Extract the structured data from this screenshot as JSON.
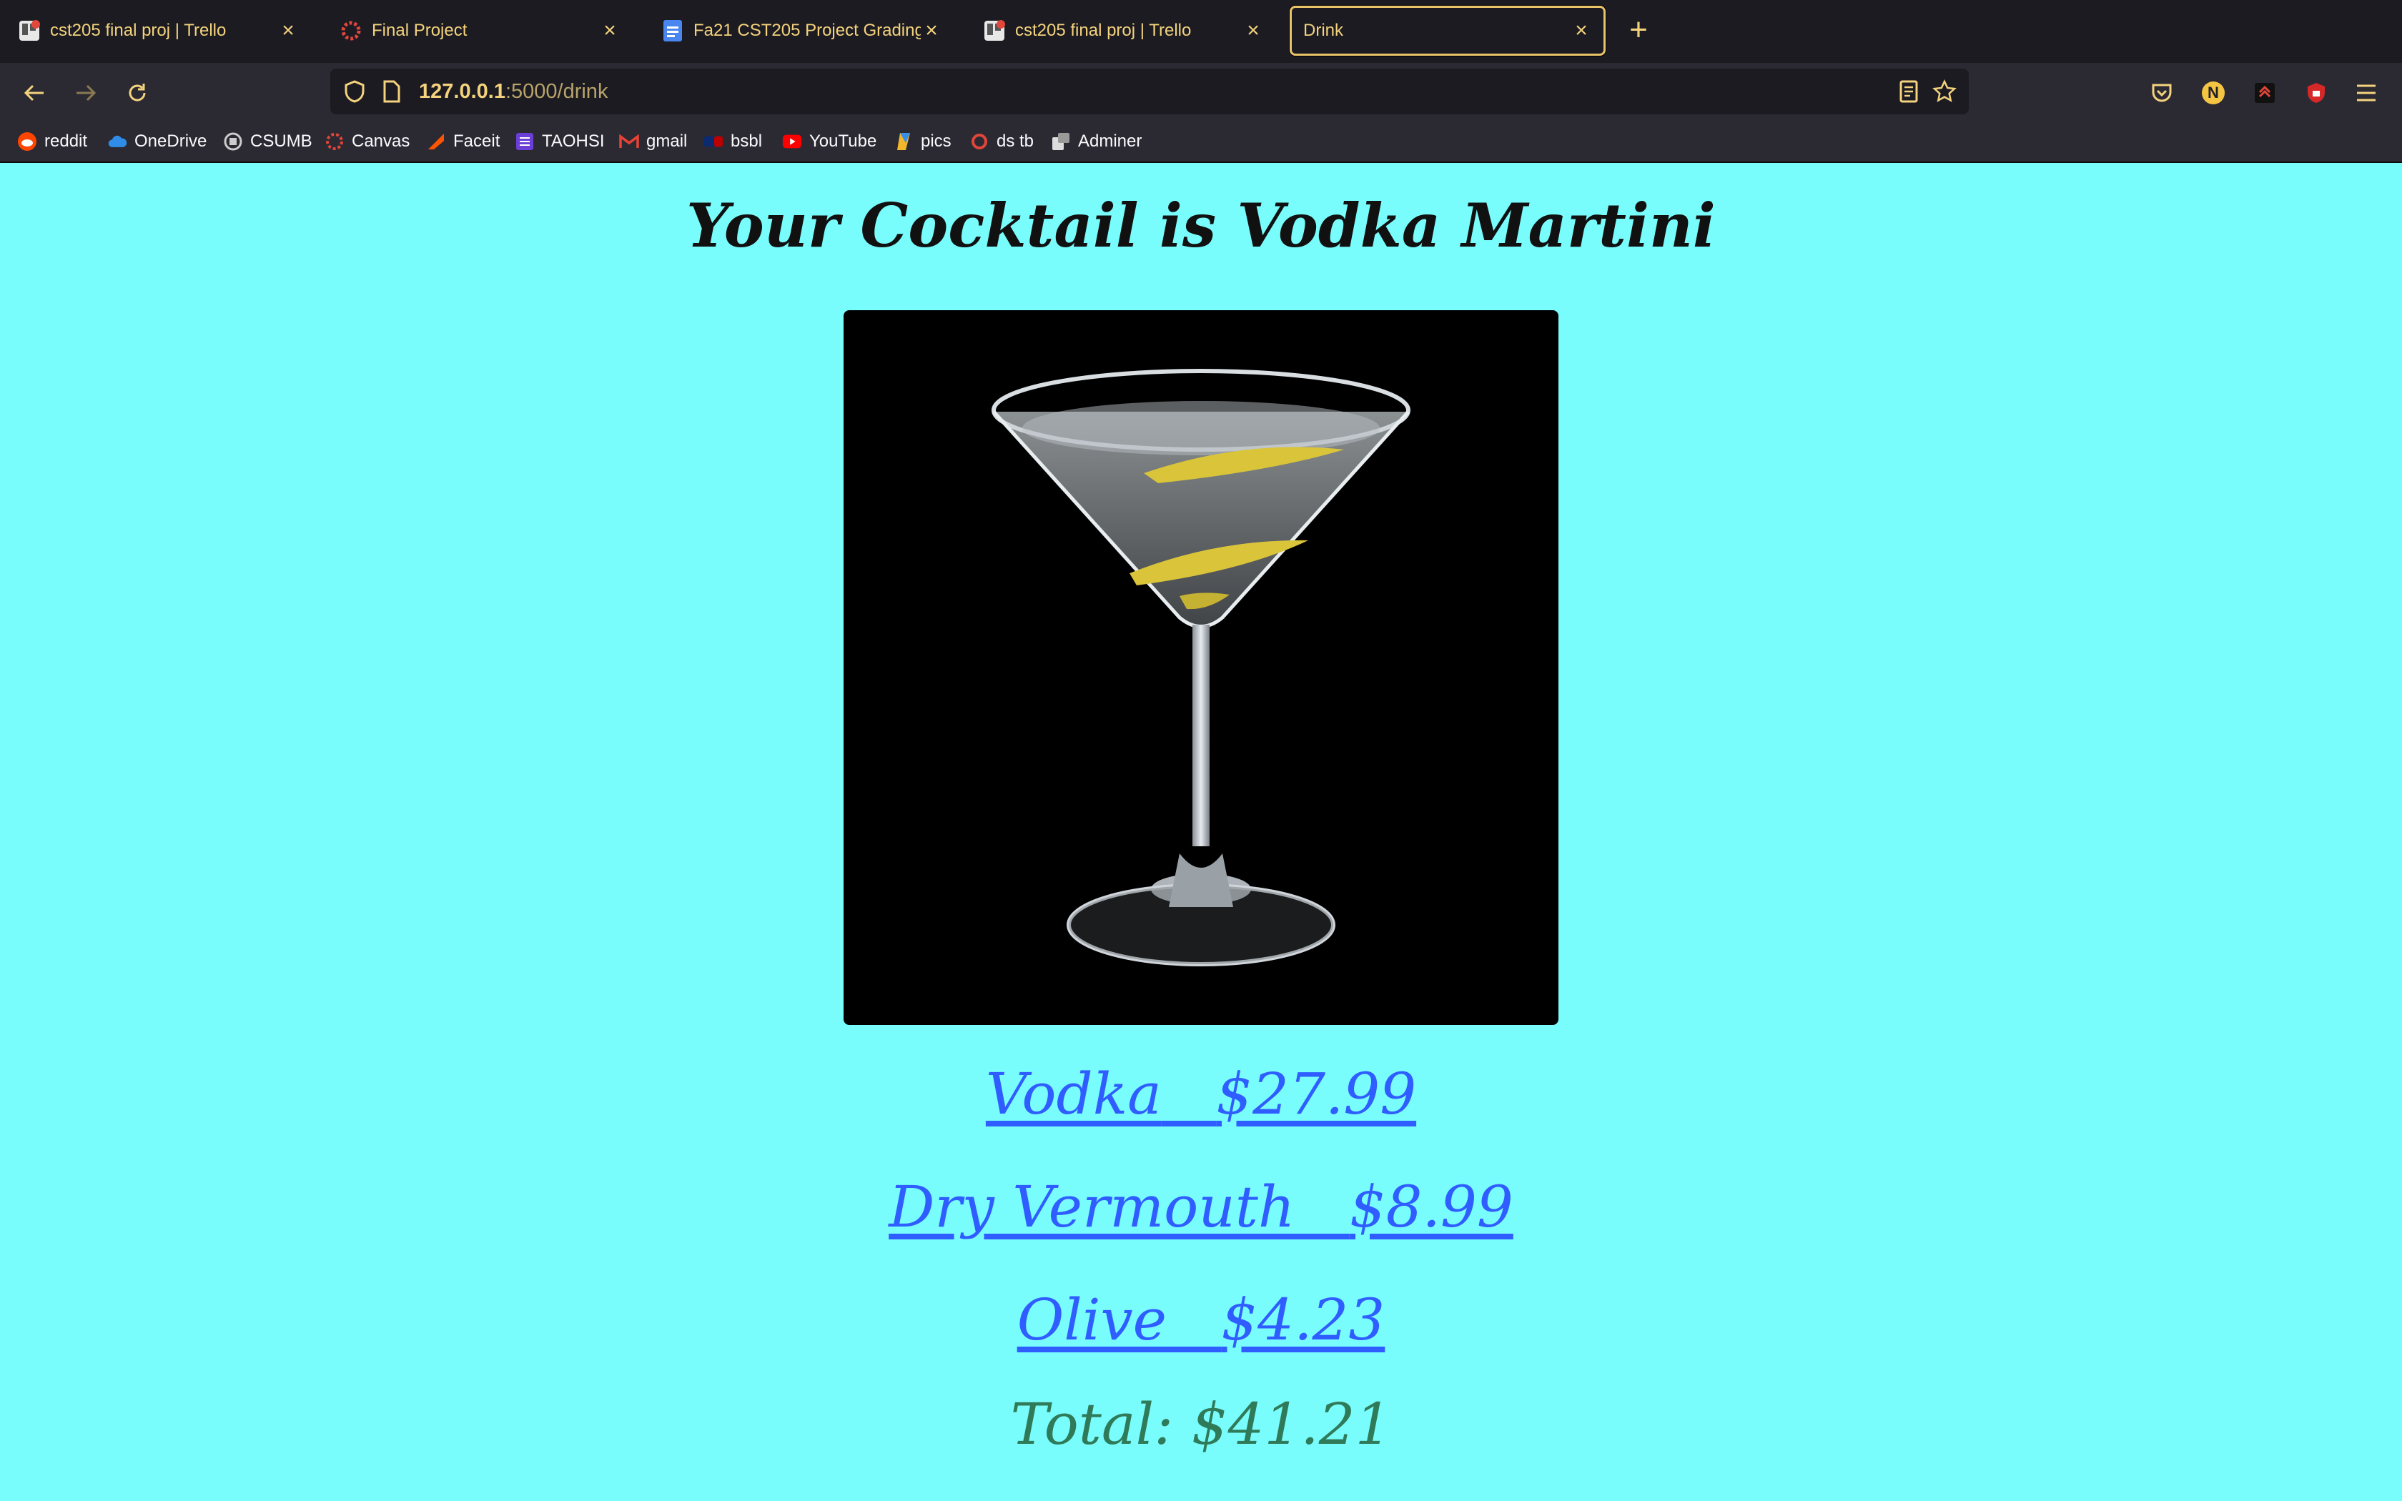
{
  "browser": {
    "tabs": [
      {
        "title": "cst205 final proj | Trello",
        "icon": "trello-icon",
        "active": false
      },
      {
        "title": "Final Project",
        "icon": "canvas-icon",
        "active": false
      },
      {
        "title": "Fa21 CST205 Project Grading -",
        "icon": "google-docs-icon",
        "active": false
      },
      {
        "title": "cst205 final proj | Trello",
        "icon": "trello-icon",
        "active": false
      },
      {
        "title": "Drink",
        "icon": "",
        "active": true
      }
    ],
    "new_tab_label": "+",
    "close_label": "×",
    "url_host": "127.0.0.1",
    "url_rest": ":5000/drink",
    "bookmarks": [
      {
        "label": "reddit",
        "icon": "reddit-icon"
      },
      {
        "label": "OneDrive",
        "icon": "cloud-icon"
      },
      {
        "label": "CSUMB",
        "icon": "csumb-icon"
      },
      {
        "label": "Canvas",
        "icon": "canvas-icon"
      },
      {
        "label": "Faceit",
        "icon": "faceit-icon"
      },
      {
        "label": "TAOHSI",
        "icon": "list-icon"
      },
      {
        "label": "gmail",
        "icon": "gmail-icon"
      },
      {
        "label": "bsbl",
        "icon": "mlb-icon"
      },
      {
        "label": "YouTube",
        "icon": "youtube-icon"
      },
      {
        "label": "pics",
        "icon": "pics-icon"
      },
      {
        "label": "ds tb",
        "icon": "ring-icon"
      },
      {
        "label": "Adminer",
        "icon": "adminer-icon"
      }
    ],
    "profile_initial": "N",
    "colors": {
      "accent": "#f4d37d",
      "tab_active_border": "#e9c46a"
    }
  },
  "page": {
    "heading": "Your Cocktail is Vodka Martini",
    "image_alt": "Vodka Martini",
    "ingredients": [
      {
        "name": "Vodka",
        "price": "$27.99"
      },
      {
        "name": "Dry Vermouth",
        "price": "$8.99"
      },
      {
        "name": "Olive",
        "price": "$4.23"
      }
    ],
    "total_label": "Total:",
    "total_value": "$41.21",
    "colors": {
      "background": "#79fcfc",
      "link": "#2f5dff",
      "total": "#2f7a58"
    }
  }
}
